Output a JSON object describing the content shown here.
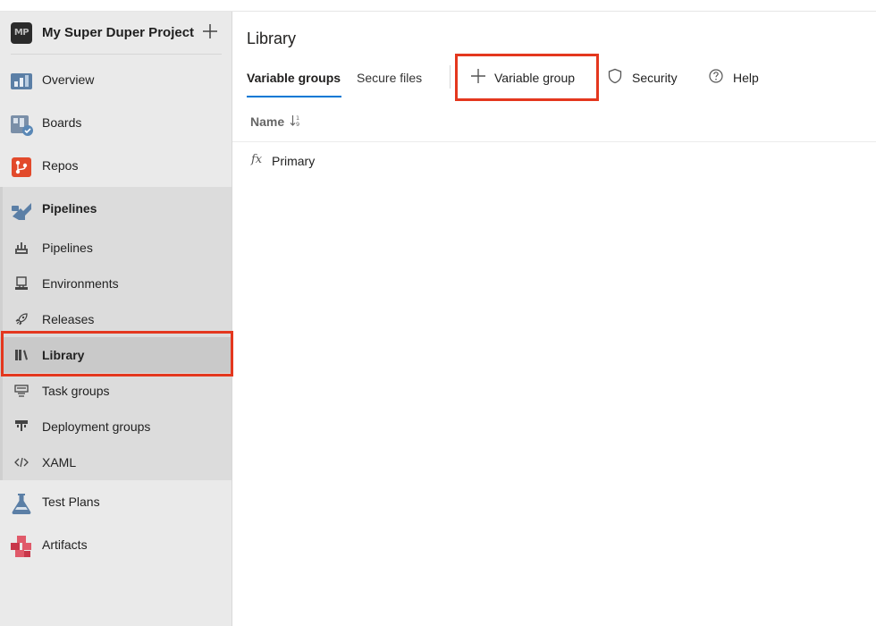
{
  "project": {
    "initials": "MP",
    "name": "My Super Duper Project"
  },
  "nav": {
    "overview": "Overview",
    "boards": "Boards",
    "repos": "Repos",
    "pipelines_group": "Pipelines",
    "pipelines_sub": [
      {
        "label": "Pipelines",
        "icon": "pipelines-icon"
      },
      {
        "label": "Environments",
        "icon": "environments-icon"
      },
      {
        "label": "Releases",
        "icon": "releases-icon"
      },
      {
        "label": "Library",
        "icon": "library-icon",
        "selected": true
      },
      {
        "label": "Task groups",
        "icon": "task-groups-icon"
      },
      {
        "label": "Deployment groups",
        "icon": "deployment-groups-icon"
      },
      {
        "label": "XAML",
        "icon": "xaml-icon"
      }
    ],
    "test_plans": "Test Plans",
    "artifacts": "Artifacts"
  },
  "page": {
    "title": "Library",
    "tabs": [
      "Variable groups",
      "Secure files"
    ],
    "active_tab": "Variable groups",
    "commands": {
      "add": "Variable group",
      "security": "Security",
      "help": "Help"
    }
  },
  "table": {
    "column": "Name",
    "rows": [
      {
        "icon": "fx",
        "name": "Primary"
      }
    ]
  },
  "colors": {
    "highlight": "#e4371e",
    "accent": "#0078d4",
    "sidebar": "#eaeaea"
  }
}
